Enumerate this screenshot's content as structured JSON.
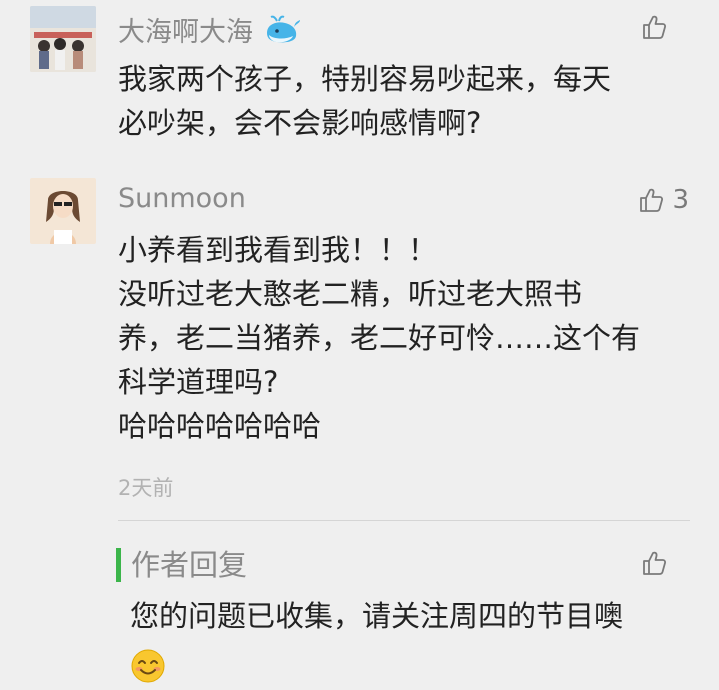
{
  "comments": [
    {
      "author": "大海啊大海",
      "author_badge": "whale-icon",
      "like_count": "",
      "content_lines": [
        "我家两个孩子，特别容易吵起来，每天",
        "必吵架，会不会影响感情啊?"
      ]
    },
    {
      "author": "Sunmoon",
      "like_count": "3",
      "content_lines": [
        "小养看到我看到我！！！",
        "没听过老大憨老二精，听过老大照书",
        "养，老二当猪养，老二好可怜……这个有",
        "科学道理吗?",
        "哈哈哈哈哈哈哈"
      ],
      "time": "2天前"
    }
  ],
  "reply": {
    "label": "作者回复",
    "content": "您的问题已收集，请关注周四的节目噢",
    "emoji": "smiling-face-icon",
    "like_count": ""
  },
  "colors": {
    "background": "#efefef",
    "name": "#8a8a8a",
    "text": "#222222",
    "meta": "#b2b2b2",
    "reply_accent": "#3bb54a"
  }
}
